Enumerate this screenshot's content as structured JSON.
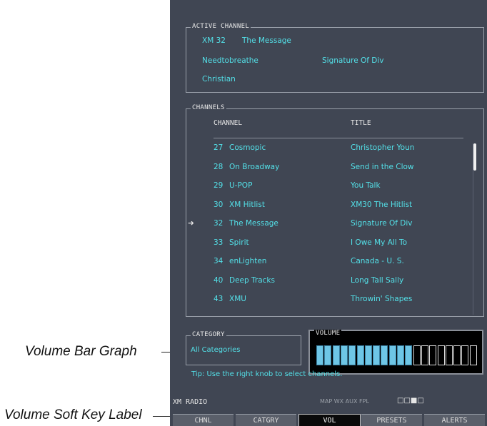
{
  "callouts": {
    "volume_bar_graph": "Volume Bar Graph",
    "volume_soft_key": "Volume Soft Key Label"
  },
  "active_channel": {
    "group_title": "ACTIVE CHANNEL",
    "channel_number": "XM 32",
    "channel_name": "The Message",
    "artist": "Needtobreathe",
    "song": "Signature Of Div",
    "category": "Christian"
  },
  "channels": {
    "group_title": "CHANNELS",
    "col_channel": "CHANNEL",
    "col_title": "TITLE",
    "selected_marker": "➜",
    "rows": [
      {
        "num": "27",
        "name": "Cosmopic",
        "title": "Christopher Youn"
      },
      {
        "num": "28",
        "name": "On Broadway",
        "title": "Send in the Clow"
      },
      {
        "num": "29",
        "name": "U-POP",
        "title": "You Talk"
      },
      {
        "num": "30",
        "name": "XM Hitlist",
        "title": "XM30 The Hitlist"
      },
      {
        "num": "32",
        "name": "The Message",
        "title": "Signature Of Div"
      },
      {
        "num": "33",
        "name": "Spirit",
        "title": "I Owe My All To"
      },
      {
        "num": "34",
        "name": "enLighten",
        "title": "Canada - U. S."
      },
      {
        "num": "40",
        "name": "Deep Tracks",
        "title": "Long Tall Sally"
      },
      {
        "num": "43",
        "name": "XMU",
        "title": "Throwin' Shapes"
      }
    ]
  },
  "category": {
    "group_title": "CATEGORY",
    "value": "All Categories"
  },
  "volume": {
    "group_title": "VOLUME",
    "level_segments_on": 12,
    "total_segments": 20,
    "on_color": "#6ec6e6"
  },
  "tip": "Tip: Use the right knob to select channels.",
  "status_bar": {
    "left": "XM RADIO",
    "right": "MAP WX AUX FPL",
    "page_dots": "□□■□"
  },
  "softkeys": [
    {
      "label": "CHNL",
      "active": false
    },
    {
      "label": "CATGRY",
      "active": false
    },
    {
      "label": "VOL",
      "active": true
    },
    {
      "label": "PRESETS",
      "active": false
    },
    {
      "label": "ALERTS",
      "active": false
    }
  ]
}
